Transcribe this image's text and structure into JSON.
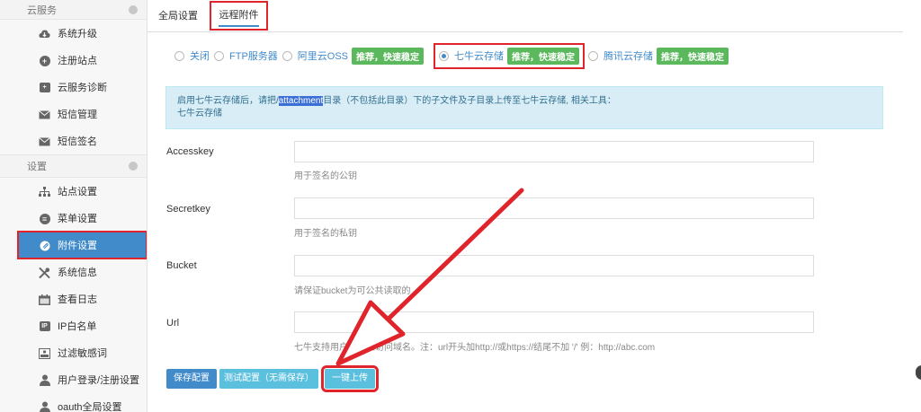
{
  "sidebar": {
    "sections": [
      {
        "title": "云服务",
        "items": [
          {
            "label": "系统升级",
            "icon": "cloud-icon"
          },
          {
            "label": "注册站点",
            "icon": "plus-circle-icon"
          },
          {
            "label": "云服务诊断",
            "icon": "medkit-icon"
          },
          {
            "label": "短信管理",
            "icon": "envelope-icon"
          },
          {
            "label": "短信签名",
            "icon": "envelope-icon"
          }
        ]
      },
      {
        "title": "设置",
        "items": [
          {
            "label": "站点设置",
            "icon": "sitemap-icon"
          },
          {
            "label": "菜单设置",
            "icon": "list-icon"
          },
          {
            "label": "附件设置",
            "icon": "paperclip-icon",
            "active": true
          },
          {
            "label": "系统信息",
            "icon": "tools-icon"
          },
          {
            "label": "查看日志",
            "icon": "calendar-icon"
          },
          {
            "label": "IP白名单",
            "icon": "ip-icon"
          },
          {
            "label": "过滤敏感词",
            "icon": "filter-icon"
          },
          {
            "label": "用户登录/注册设置",
            "icon": "user-icon"
          },
          {
            "label": "oauth全局设置",
            "icon": "user-icon"
          }
        ]
      }
    ]
  },
  "tabs": [
    {
      "label": "全局设置"
    },
    {
      "label": "远程附件",
      "active": true
    }
  ],
  "storage_options": {
    "options": [
      {
        "label": "关闭",
        "selected": false
      },
      {
        "label": "FTP服务器",
        "selected": false
      },
      {
        "label": "阿里云OSS",
        "selected": false,
        "badge": "推荐，快速稳定"
      },
      {
        "label": "七牛云存储",
        "selected": true,
        "badge": "推荐，快速稳定"
      },
      {
        "label": "腾讯云存储",
        "selected": false,
        "badge": "推荐，快速稳定"
      }
    ]
  },
  "info": {
    "line1_pre": "启用七牛云存储后，请把/",
    "line1_hl": "attachment",
    "line1_post": "目录（不包括此目录）下的子文件及子目录上传至七牛云存储, 相关工具：",
    "line2": "七牛云存储"
  },
  "form": {
    "accesskey": {
      "label": "Accesskey",
      "value": "",
      "help": "用于签名的公钥"
    },
    "secretkey": {
      "label": "Secretkey",
      "value": "",
      "help": "用于签名的私钥"
    },
    "bucket": {
      "label": "Bucket",
      "value": "",
      "help": "请保证bucket为可公共读取的"
    },
    "url": {
      "label": "Url",
      "value": "",
      "help": "七牛支持用户自定义访问域名。注：url开头加http://或https://结尾不加  '/'  例：http://abc.com"
    }
  },
  "buttons": {
    "save": "保存配置",
    "test": "测试配置（无需保存）",
    "upload": "一键上传"
  },
  "colors": {
    "primary": "#428bca",
    "info": "#5bc0de",
    "success": "#5cb85c",
    "highlight_red": "#e0242b"
  }
}
